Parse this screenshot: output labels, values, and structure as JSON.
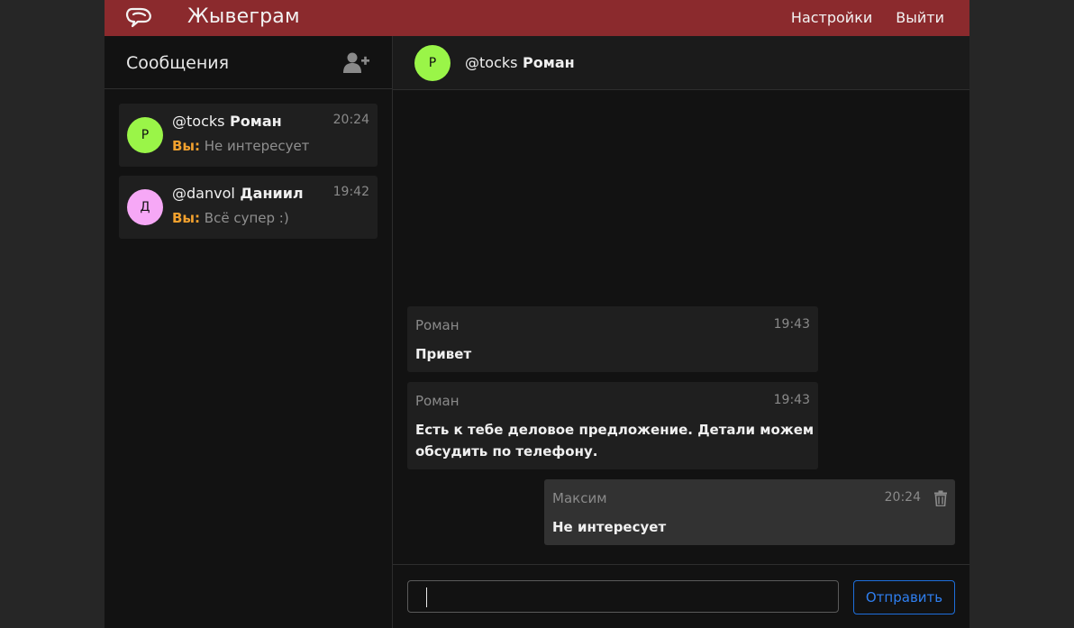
{
  "app": {
    "brand": "Жывеграм"
  },
  "nav": {
    "settings": "Настройки",
    "logout": "Выйти"
  },
  "sidebar": {
    "title": "Сообщения",
    "chats": [
      {
        "avatar": "Р",
        "avatar_color": "#9af548",
        "handle": "@tocks",
        "name": "Роман",
        "time": "20:24",
        "you_label": "Вы:",
        "preview": "Не интересует"
      },
      {
        "avatar": "Д",
        "avatar_color": "#f6a8f6",
        "handle": "@danvol",
        "name": "Даниил",
        "time": "19:42",
        "you_label": "Вы:",
        "preview": "Всё супер :)"
      }
    ]
  },
  "conversation": {
    "avatar": "Р",
    "avatar_color": "#9af548",
    "handle": "@tocks",
    "name": "Роман",
    "messages": [
      {
        "author": "Роман",
        "time": "19:43",
        "lines": [
          "Привет"
        ],
        "mine": false
      },
      {
        "author": "Роман",
        "time": "19:43",
        "lines": [
          "Есть к тебе деловое предложение. Детали можем",
          "обсудить по телефону."
        ],
        "mine": false
      },
      {
        "author": "Максим",
        "time": "20:24",
        "lines": [
          "Не интересует"
        ],
        "mine": true
      }
    ]
  },
  "composer": {
    "value": "",
    "send_label": "Отправить"
  },
  "colors": {
    "topbar": "#8b2a2d",
    "accent_you": "#f2a12e",
    "send": "#2f7ff0"
  }
}
